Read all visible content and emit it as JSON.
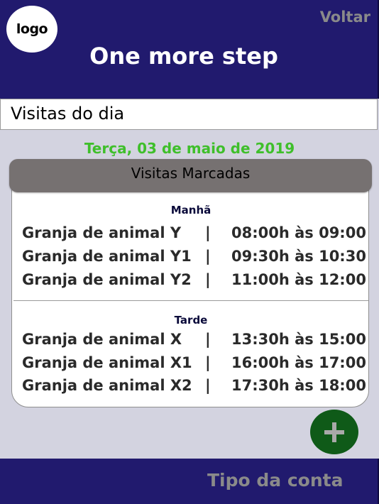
{
  "header": {
    "logo_text": "logo",
    "back_label": "Voltar",
    "title": "One more step"
  },
  "section": {
    "title": "Visitas do dia"
  },
  "date": "Terça, 03 de maio de 2019",
  "card": {
    "title": "Visitas Marcadas",
    "periods": [
      {
        "label": "Manhã",
        "visits": [
          {
            "name": "Granja de animal Y",
            "sep": "|",
            "time": "08:00h às 09:00"
          },
          {
            "name": "Granja de animal Y1",
            "sep": "|",
            "time": "09:30h às 10:30"
          },
          {
            "name": "Granja de animal Y2",
            "sep": "|",
            "time": "11:00h às 12:00"
          }
        ]
      },
      {
        "label": "Tarde",
        "visits": [
          {
            "name": "Granja de animal X",
            "sep": "|",
            "time": "13:30h às 15:00"
          },
          {
            "name": "Granja de animal X1",
            "sep": "|",
            "time": "16:00h às 17:00"
          },
          {
            "name": "Granja de animal X2",
            "sep": "|",
            "time": "17:30h às 18:00"
          }
        ]
      }
    ]
  },
  "add_button": {
    "icon": "plus-icon"
  },
  "footer": {
    "label": "Tipo da conta"
  },
  "colors": {
    "header_bg": "#211a6e",
    "date_text": "#3fbf2b",
    "card_header_bg": "#767171",
    "add_button_bg": "#0f5a18",
    "page_bg": "#d3d3e0"
  }
}
